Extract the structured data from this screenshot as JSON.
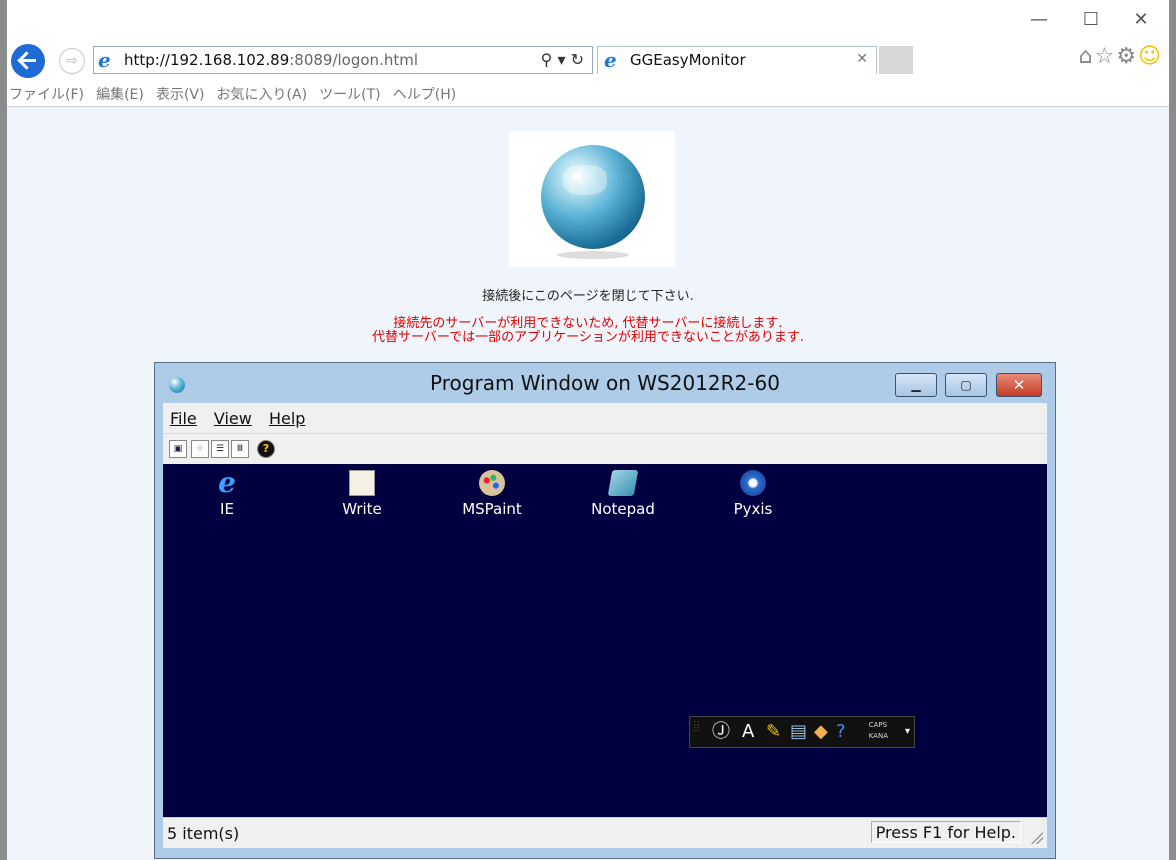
{
  "browser": {
    "url": "http://192.168.102.89:8089/logon.html",
    "url_host": "http://192.168.102.89",
    "url_rest": ":8089/logon.html",
    "tab_title": "GGEasyMonitor",
    "menu": [
      "ファイル(F)",
      "編集(E)",
      "表示(V)",
      "お気に入り(A)",
      "ツール(T)",
      "ヘルプ(H)"
    ]
  },
  "page": {
    "message": "接続後にこのページを閉じて下さい.",
    "warning_line1": "接続先のサーバーが利用できないため, 代替サーバーに接続します.",
    "warning_line2": "代替サーバーでは一部のアプリケーションが利用できないことがあります."
  },
  "program_window": {
    "title": "Program Window on WS2012R2-60",
    "menu": [
      "File",
      "View",
      "Help"
    ],
    "apps": [
      {
        "label": "IE",
        "icon": "ie-icon"
      },
      {
        "label": "Write",
        "icon": "write-icon"
      },
      {
        "label": "MSPaint",
        "icon": "paint-icon"
      },
      {
        "label": "Notepad",
        "icon": "notepad-icon"
      },
      {
        "label": "Pyxis",
        "icon": "pyxis-icon"
      }
    ],
    "status_left": "5 item(s)",
    "status_right": "Press F1 for Help.",
    "langbar_caps": "CAPS",
    "langbar_kana": "KANA"
  },
  "colors": {
    "page_bg": "#f0f4fb",
    "warning": "#e00000",
    "desktop_bg": "#000040",
    "back_button": "#1e6bd6"
  }
}
